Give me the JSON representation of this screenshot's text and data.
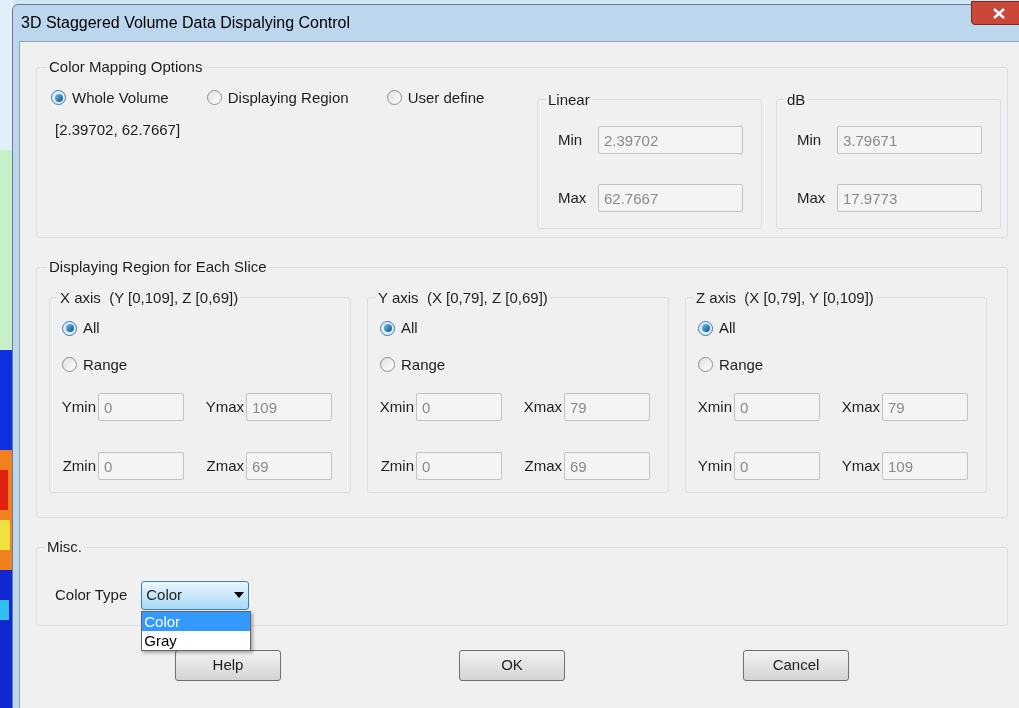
{
  "window": {
    "title": "3D Staggered Volume Data Dispalying Control"
  },
  "color_mapping": {
    "title": "Color Mapping Options",
    "options": [
      {
        "label": "Whole Volume",
        "selected": true
      },
      {
        "label": "Displaying Region",
        "selected": false
      },
      {
        "label": "User define",
        "selected": false
      }
    ],
    "range_text": "[2.39702, 62.7667]",
    "scales": [
      {
        "title": "Linear",
        "fields": [
          {
            "label": "Min",
            "value": "2.39702",
            "disabled": true
          },
          {
            "label": "Max",
            "value": "62.7667",
            "disabled": true
          }
        ]
      },
      {
        "title": "dB",
        "fields": [
          {
            "label": "Min",
            "value": "3.79671",
            "disabled": true
          },
          {
            "label": "Max",
            "value": "17.9773",
            "disabled": true
          }
        ]
      }
    ]
  },
  "region": {
    "title": "Displaying Region for Each Slice",
    "axes": [
      {
        "title": "X axis  (Y [0,109], Z [0,69])",
        "modes": [
          {
            "label": "All",
            "selected": true
          },
          {
            "label": "Range",
            "selected": false
          }
        ],
        "fields": [
          {
            "label": "Ymin",
            "value": "0",
            "disabled": true
          },
          {
            "label": "Ymax",
            "value": "109",
            "disabled": true
          },
          {
            "label": "Zmin",
            "value": "0",
            "disabled": true
          },
          {
            "label": "Zmax",
            "value": "69",
            "disabled": true
          }
        ]
      },
      {
        "title": "Y axis  (X [0,79], Z [0,69])",
        "modes": [
          {
            "label": "All",
            "selected": true
          },
          {
            "label": "Range",
            "selected": false
          }
        ],
        "fields": [
          {
            "label": "Xmin",
            "value": "0",
            "disabled": true
          },
          {
            "label": "Xmax",
            "value": "79",
            "disabled": true
          },
          {
            "label": "Zmin",
            "value": "0",
            "disabled": true
          },
          {
            "label": "Zmax",
            "value": "69",
            "disabled": true
          }
        ]
      },
      {
        "title": "Z axis  (X [0,79], Y [0,109])",
        "modes": [
          {
            "label": "All",
            "selected": true
          },
          {
            "label": "Range",
            "selected": false
          }
        ],
        "fields": [
          {
            "label": "Xmin",
            "value": "0",
            "disabled": true
          },
          {
            "label": "Xmax",
            "value": "79",
            "disabled": true
          },
          {
            "label": "Ymin",
            "value": "0",
            "disabled": true
          },
          {
            "label": "Ymax",
            "value": "109",
            "disabled": true
          }
        ]
      }
    ]
  },
  "misc": {
    "title": "Misc.",
    "color_type": {
      "label": "Color Type",
      "value": "Color",
      "expanded": true,
      "options": [
        {
          "label": "Color",
          "selected": true
        },
        {
          "label": "Gray",
          "selected": false
        }
      ]
    }
  },
  "buttons": [
    "Help",
    "OK",
    "Cancel"
  ]
}
